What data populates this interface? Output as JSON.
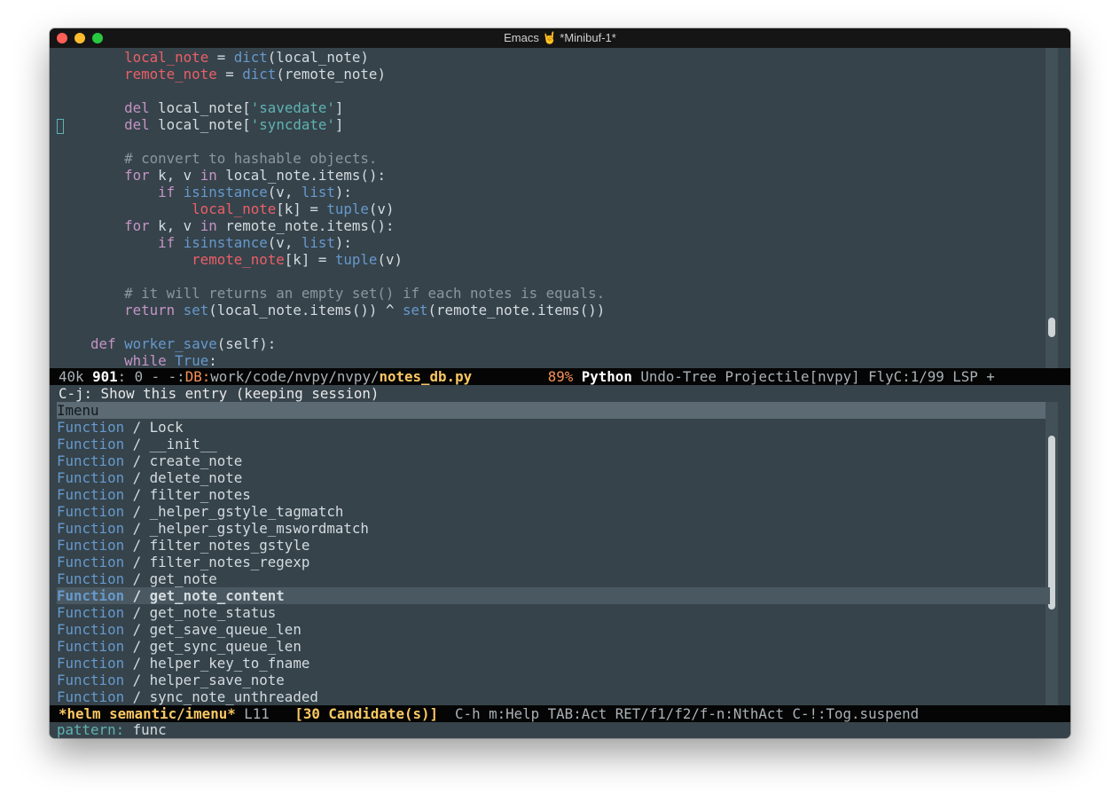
{
  "window": {
    "title": "Emacs 🤘  *Minibuf-1*"
  },
  "editor": {
    "lines": [
      {
        "segments": [
          {
            "t": "        ",
            "c": ""
          },
          {
            "t": "local_note",
            "c": "var"
          },
          {
            "t": " = ",
            "c": ""
          },
          {
            "t": "dict",
            "c": "fn"
          },
          {
            "t": "(local_note)",
            "c": ""
          }
        ]
      },
      {
        "segments": [
          {
            "t": "        ",
            "c": ""
          },
          {
            "t": "remote_note",
            "c": "var"
          },
          {
            "t": " = ",
            "c": ""
          },
          {
            "t": "dict",
            "c": "fn"
          },
          {
            "t": "(remote_note)",
            "c": ""
          }
        ]
      },
      {
        "segments": [
          {
            "t": "",
            "c": ""
          }
        ]
      },
      {
        "segments": [
          {
            "t": "        ",
            "c": ""
          },
          {
            "t": "del",
            "c": "kw"
          },
          {
            "t": " local_note[",
            "c": ""
          },
          {
            "t": "'savedate'",
            "c": "str"
          },
          {
            "t": "]",
            "c": ""
          }
        ]
      },
      {
        "segments": [
          {
            "t": "        ",
            "c": ""
          },
          {
            "t": "del",
            "c": "kw"
          },
          {
            "t": " local_note[",
            "c": ""
          },
          {
            "t": "'syncdate'",
            "c": "str"
          },
          {
            "t": "]",
            "c": ""
          }
        ]
      },
      {
        "segments": [
          {
            "t": "",
            "c": ""
          }
        ]
      },
      {
        "segments": [
          {
            "t": "        ",
            "c": ""
          },
          {
            "t": "# convert to hashable objects.",
            "c": "com"
          }
        ]
      },
      {
        "segments": [
          {
            "t": "        ",
            "c": ""
          },
          {
            "t": "for",
            "c": "kw"
          },
          {
            "t": " k, v ",
            "c": ""
          },
          {
            "t": "in",
            "c": "kw"
          },
          {
            "t": " local_note.items():",
            "c": ""
          }
        ]
      },
      {
        "segments": [
          {
            "t": "            ",
            "c": ""
          },
          {
            "t": "if",
            "c": "kw"
          },
          {
            "t": " ",
            "c": ""
          },
          {
            "t": "isinstance",
            "c": "fn"
          },
          {
            "t": "(v, ",
            "c": ""
          },
          {
            "t": "list",
            "c": "fn"
          },
          {
            "t": "):",
            "c": ""
          }
        ]
      },
      {
        "segments": [
          {
            "t": "                ",
            "c": ""
          },
          {
            "t": "local_note",
            "c": "var"
          },
          {
            "t": "[k] = ",
            "c": ""
          },
          {
            "t": "tuple",
            "c": "fn"
          },
          {
            "t": "(v)",
            "c": ""
          }
        ]
      },
      {
        "segments": [
          {
            "t": "        ",
            "c": ""
          },
          {
            "t": "for",
            "c": "kw"
          },
          {
            "t": " k, v ",
            "c": ""
          },
          {
            "t": "in",
            "c": "kw"
          },
          {
            "t": " remote_note.items():",
            "c": ""
          }
        ]
      },
      {
        "segments": [
          {
            "t": "            ",
            "c": ""
          },
          {
            "t": "if",
            "c": "kw"
          },
          {
            "t": " ",
            "c": ""
          },
          {
            "t": "isinstance",
            "c": "fn"
          },
          {
            "t": "(v, ",
            "c": ""
          },
          {
            "t": "list",
            "c": "fn"
          },
          {
            "t": "):",
            "c": ""
          }
        ]
      },
      {
        "segments": [
          {
            "t": "                ",
            "c": ""
          },
          {
            "t": "remote_note",
            "c": "var"
          },
          {
            "t": "[k] = ",
            "c": ""
          },
          {
            "t": "tuple",
            "c": "fn"
          },
          {
            "t": "(v)",
            "c": ""
          }
        ]
      },
      {
        "segments": [
          {
            "t": "",
            "c": ""
          }
        ]
      },
      {
        "segments": [
          {
            "t": "        ",
            "c": ""
          },
          {
            "t": "# it will returns an empty set() if each notes is equals.",
            "c": "com"
          }
        ]
      },
      {
        "segments": [
          {
            "t": "        ",
            "c": ""
          },
          {
            "t": "return",
            "c": "kw"
          },
          {
            "t": " ",
            "c": ""
          },
          {
            "t": "set",
            "c": "fn"
          },
          {
            "t": "(local_note.items()) ^ ",
            "c": ""
          },
          {
            "t": "set",
            "c": "fn"
          },
          {
            "t": "(remote_note.items())",
            "c": ""
          }
        ]
      },
      {
        "segments": [
          {
            "t": "",
            "c": ""
          }
        ]
      },
      {
        "segments": [
          {
            "t": "    ",
            "c": ""
          },
          {
            "t": "def",
            "c": "def"
          },
          {
            "t": " ",
            "c": ""
          },
          {
            "t": "worker_save",
            "c": "fn"
          },
          {
            "t": "(self):",
            "c": ""
          }
        ]
      },
      {
        "segments": [
          {
            "t": "        ",
            "c": ""
          },
          {
            "t": "while",
            "c": "kw"
          },
          {
            "t": " ",
            "c": ""
          },
          {
            "t": "True",
            "c": "fn"
          },
          {
            "t": ":",
            "c": ""
          }
        ]
      }
    ]
  },
  "modeline": {
    "size": "40k",
    "line": "901",
    "col": ": 0 - -:",
    "vc": "DB:",
    "path": "work/code/nvpy/nvpy/",
    "file": "notes_db.py",
    "percent": "89%",
    "major_mode": "Python",
    "minor_modes": "Undo-Tree Projectile[nvpy] FlyC:1/99 LSP +"
  },
  "echo": {
    "text": "C-j: Show this entry (keeping session)"
  },
  "helm": {
    "header": "Imenu",
    "items": [
      {
        "kind": "Function",
        "sep": " / ",
        "name": "Lock"
      },
      {
        "kind": "Function",
        "sep": " / ",
        "name": "__init__"
      },
      {
        "kind": "Function",
        "sep": " / ",
        "name": "create_note"
      },
      {
        "kind": "Function",
        "sep": " / ",
        "name": "delete_note"
      },
      {
        "kind": "Function",
        "sep": " / ",
        "name": "filter_notes"
      },
      {
        "kind": "Function",
        "sep": " / ",
        "name": "_helper_gstyle_tagmatch"
      },
      {
        "kind": "Function",
        "sep": " / ",
        "name": "_helper_gstyle_mswordmatch"
      },
      {
        "kind": "Function",
        "sep": " / ",
        "name": "filter_notes_gstyle"
      },
      {
        "kind": "Function",
        "sep": " / ",
        "name": "filter_notes_regexp"
      },
      {
        "kind": "Function",
        "sep": " / ",
        "name": "get_note"
      },
      {
        "kind": "Function",
        "sep": " / ",
        "name": "get_note_content",
        "selected": true
      },
      {
        "kind": "Function",
        "sep": " / ",
        "name": "get_note_status"
      },
      {
        "kind": "Function",
        "sep": " / ",
        "name": "get_save_queue_len"
      },
      {
        "kind": "Function",
        "sep": " / ",
        "name": "get_sync_queue_len"
      },
      {
        "kind": "Function",
        "sep": " / ",
        "name": "helper_key_to_fname"
      },
      {
        "kind": "Function",
        "sep": " / ",
        "name": "helper_save_note"
      },
      {
        "kind": "Function",
        "sep": " / ",
        "name": "sync_note_unthreaded"
      }
    ],
    "modeline": {
      "buffer": "*helm semantic/imenu*",
      "line": " L11",
      "candidates": "[30 Candidate(s)]",
      "help": "C-h m:Help TAB:Act RET/f1/f2/f-n:NthAct C-!:Tog.suspend"
    },
    "prompt_label": "pattern:",
    "pattern": "func"
  },
  "colors": {
    "background": "#36434b",
    "modeline_bg": "#050505",
    "variable": "#ec5f67",
    "keyword": "#c594c5",
    "function": "#6699cc",
    "string": "#5fb3b3",
    "comment": "#8a97a0",
    "accent_yellow": "#fac863",
    "accent_orange": "#f99157"
  }
}
